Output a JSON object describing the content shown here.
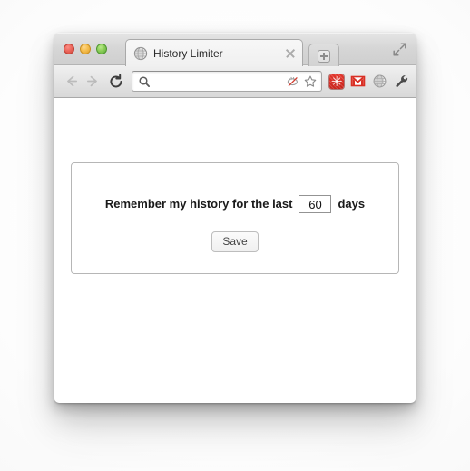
{
  "window": {
    "traffic_lights": [
      {
        "name": "close",
        "color": "#ed6a5f"
      },
      {
        "name": "minimize",
        "color": "#f6bf50"
      },
      {
        "name": "zoom",
        "color": "#8ed05a"
      }
    ],
    "fullscreen_icon": "fullscreen-arrows-icon"
  },
  "tab": {
    "title": "History Limiter",
    "favicon": "globe-icon",
    "close_label": "×",
    "new_tab_label": "+"
  },
  "toolbar": {
    "back_icon": "back-arrow-icon",
    "forward_icon": "forward-arrow-icon",
    "reload_icon": "reload-icon",
    "omnibox": {
      "value": "",
      "placeholder": "",
      "search_icon": "magnifier-icon",
      "block_icon": "popup-blocked-icon",
      "bookmark_icon": "star-outline-icon"
    },
    "extensions": [
      {
        "name": "asterisk-extension-icon",
        "glyph": "✳",
        "color": "#d0261d"
      },
      {
        "name": "gmail-icon",
        "glyph": "M",
        "color": "#d93025"
      },
      {
        "name": "globe-extension-icon",
        "glyph": "",
        "color": "#9a9a9a"
      },
      {
        "name": "wrench-menu-icon",
        "glyph": "",
        "color": "#555555"
      }
    ]
  },
  "page": {
    "form": {
      "label_before": "Remember my history for the last",
      "days_value": "60",
      "days_placeholder": "60",
      "label_after": "days",
      "save_label": "Save"
    }
  }
}
